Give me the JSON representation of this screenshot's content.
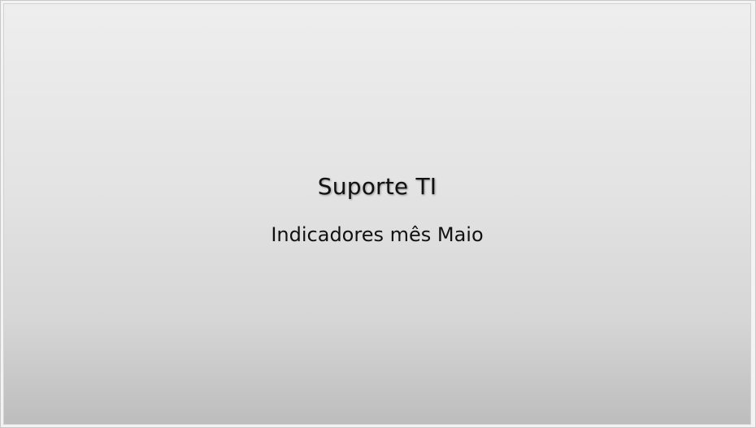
{
  "slide": {
    "title": "Suporte TI",
    "subtitle": "Indicadores mês Maio"
  },
  "colors": {
    "background_top": "#eeeeee",
    "background_bottom": "#bdbdbd",
    "text": "#111111"
  }
}
